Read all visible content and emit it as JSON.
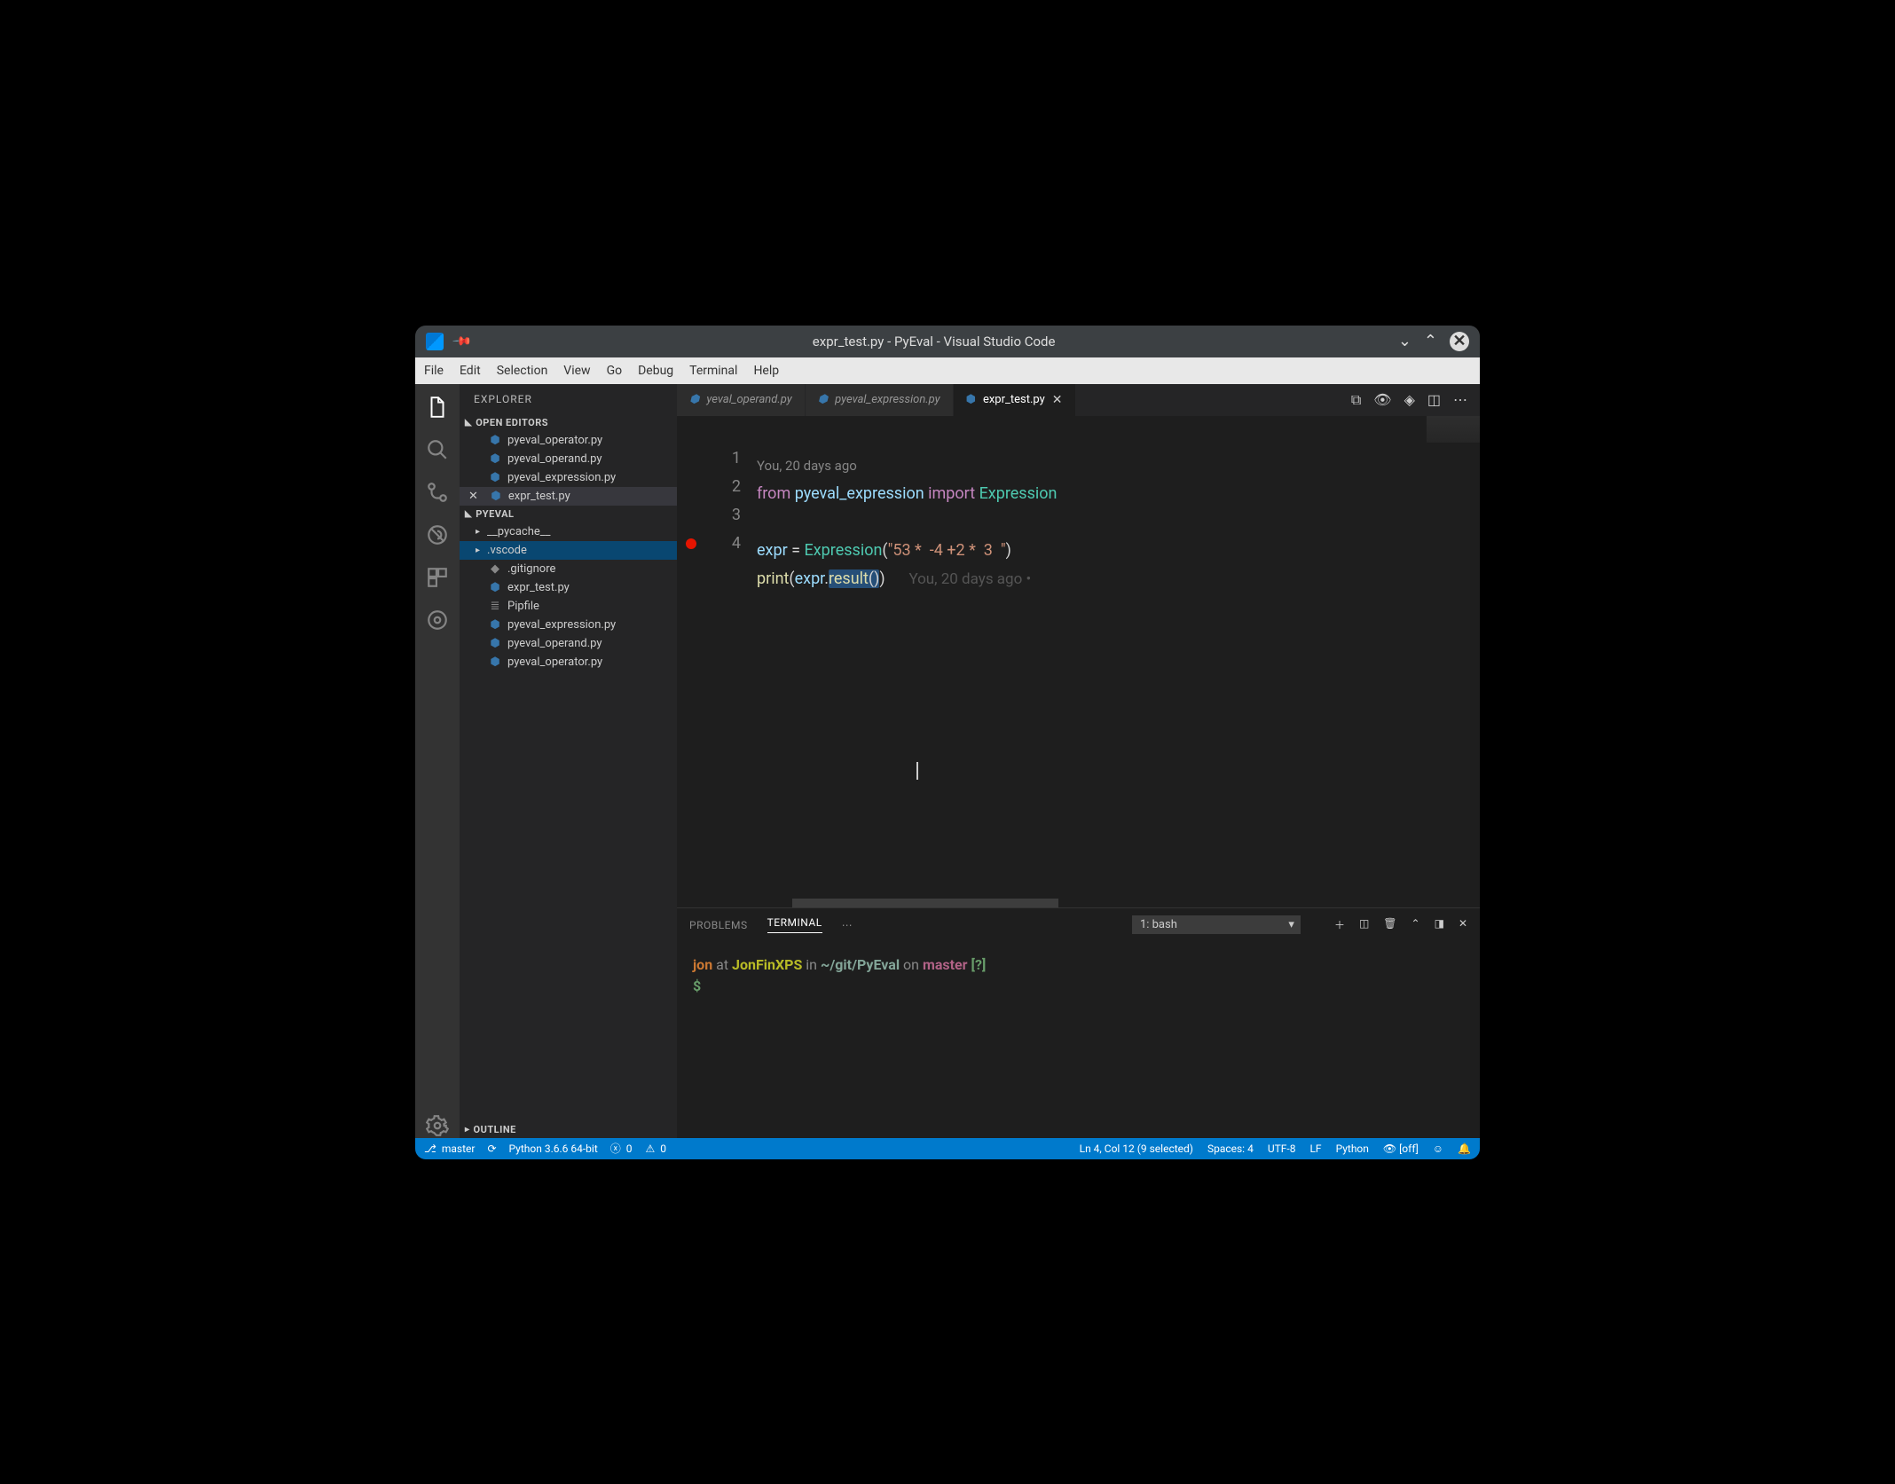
{
  "titlebar": {
    "title": "expr_test.py - PyEval - Visual Studio Code"
  },
  "menu": [
    "File",
    "Edit",
    "Selection",
    "View",
    "Go",
    "Debug",
    "Terminal",
    "Help"
  ],
  "sidebar": {
    "title": "EXPLORER",
    "open_editors_header": "OPEN EDITORS",
    "open_editors": [
      {
        "label": "pyeval_operator.py"
      },
      {
        "label": "pyeval_operand.py"
      },
      {
        "label": "pyeval_expression.py"
      },
      {
        "label": "expr_test.py",
        "active": true
      }
    ],
    "project_header": "PYEVAL",
    "project_items": [
      {
        "label": "__pycache__",
        "type": "folder"
      },
      {
        "label": ".vscode",
        "type": "folder",
        "selected": true
      },
      {
        "label": ".gitignore",
        "type": "file",
        "icon": "◇"
      },
      {
        "label": "expr_test.py",
        "type": "py"
      },
      {
        "label": "Pipfile",
        "type": "file",
        "icon": "≣"
      },
      {
        "label": "pyeval_expression.py",
        "type": "py"
      },
      {
        "label": "pyeval_operand.py",
        "type": "py"
      },
      {
        "label": "pyeval_operator.py",
        "type": "py"
      }
    ],
    "outline_header": "OUTLINE"
  },
  "tabs": [
    {
      "label": "yeval_operand.py",
      "active": false
    },
    {
      "label": "pyeval_expression.py",
      "active": false
    },
    {
      "label": "expr_test.py",
      "active": true
    }
  ],
  "editor": {
    "codelens": "You, 20 days ago",
    "lines": [
      "1",
      "2",
      "3",
      "4"
    ],
    "breakpoint_line": 4,
    "line1": {
      "from": "from",
      "module": "pyeval_expression",
      "import": "import",
      "cls": "Expression"
    },
    "line3": {
      "var": "expr",
      "eq": " = ",
      "cls": "Expression",
      "lp": "(",
      "str": "\"53 *  -4 +2 *  3  \"",
      "rp": ")"
    },
    "line4": {
      "print": "print",
      "lp": "(",
      "var": "expr",
      "dot": ".",
      "method": "result",
      "paren": "()",
      "rp": ")",
      "blame": "You, 20 days ago •"
    }
  },
  "panel": {
    "problems_label": "PROBLEMS",
    "terminal_label": "TERMINAL",
    "select": "1: bash",
    "prompt": {
      "user": "jon",
      "at": " at ",
      "host": "JonFinXPS",
      "in": " in ",
      "path": "~/git/PyEval",
      "on": " on ",
      "branch": "master",
      "ind": " [?]",
      "ps": "$"
    }
  },
  "status": {
    "branch": "master",
    "python": "Python 3.6.6 64-bit",
    "errors": "0",
    "warnings": "0",
    "cursor": "Ln 4, Col 12 (9 selected)",
    "spaces": "Spaces: 4",
    "encoding": "UTF-8",
    "eol": "LF",
    "lang": "Python",
    "live": "[off]"
  }
}
